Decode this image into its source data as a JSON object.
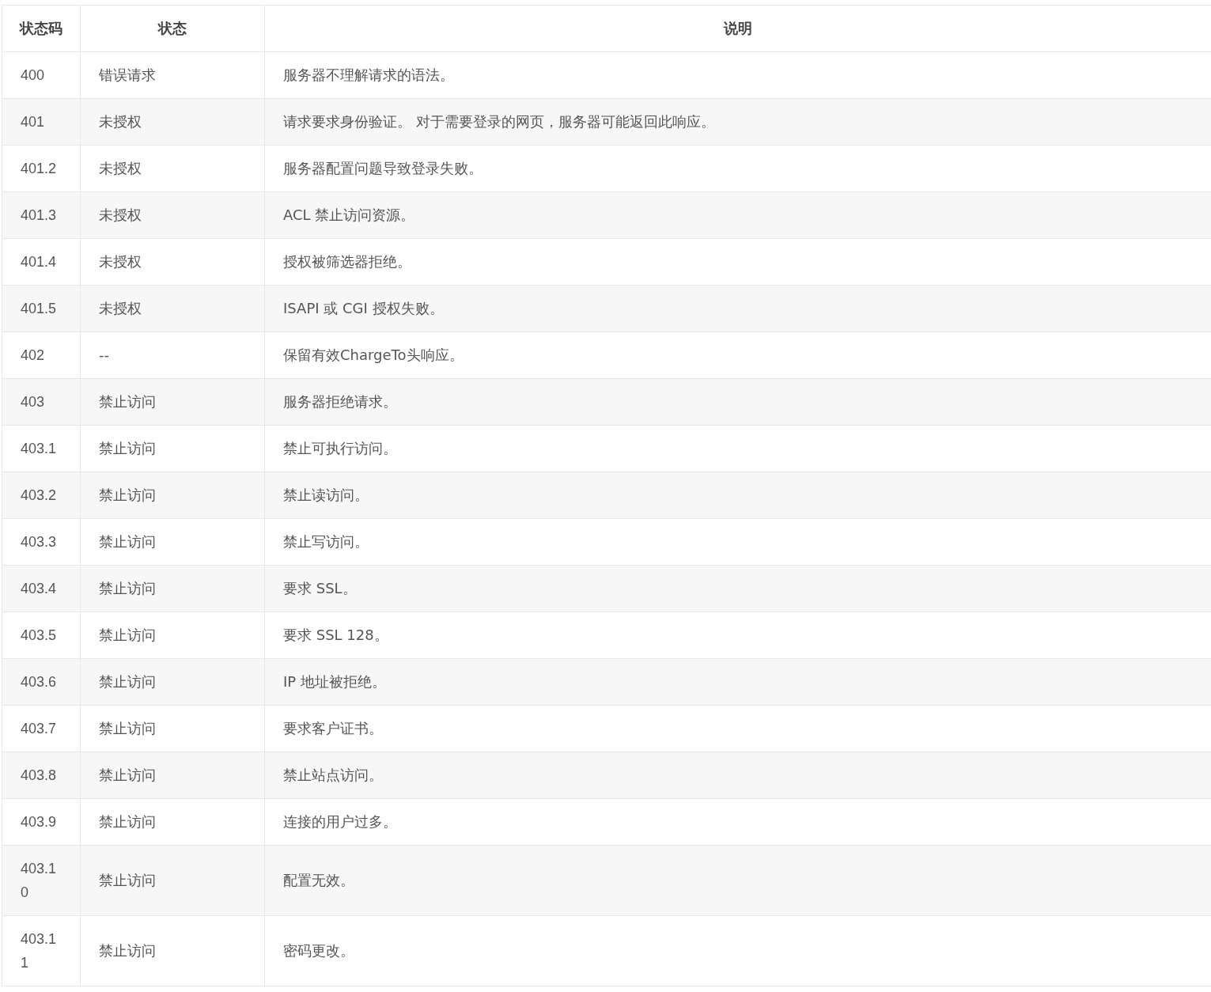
{
  "table": {
    "columns": [
      "状态码",
      "状态",
      "说明"
    ],
    "rows": [
      [
        "400",
        "错误请求",
        "服务器不理解请求的语法。"
      ],
      [
        "401",
        "未授权",
        "请求要求身份验证。 对于需要登录的网页，服务器可能返回此响应。"
      ],
      [
        "401.2",
        "未授权",
        "服务器配置问题导致登录失败。"
      ],
      [
        "401.3",
        "未授权",
        "ACL 禁止访问资源。"
      ],
      [
        "401.4",
        "未授权",
        "授权被筛选器拒绝。"
      ],
      [
        "401.5",
        "未授权",
        "ISAPI 或 CGI 授权失败。"
      ],
      [
        "402",
        "--",
        "保留有效ChargeTo头响应。"
      ],
      [
        "403",
        "禁止访问",
        "服务器拒绝请求。"
      ],
      [
        "403.1",
        "禁止访问",
        "禁止可执行访问。"
      ],
      [
        "403.2",
        "禁止访问",
        "禁止读访问。"
      ],
      [
        "403.3",
        "禁止访问",
        "禁止写访问。"
      ],
      [
        "403.4",
        "禁止访问",
        "要求 SSL。"
      ],
      [
        "403.5",
        "禁止访问",
        "要求 SSL 128。"
      ],
      [
        "403.6",
        "禁止访问",
        "IP 地址被拒绝。"
      ],
      [
        "403.7",
        "禁止访问",
        "要求客户证书。"
      ],
      [
        "403.8",
        "禁止访问",
        "禁止站点访问。"
      ],
      [
        "403.9",
        "禁止访问",
        "连接的用户过多。"
      ],
      [
        "403.10",
        "禁止访问",
        "配置无效。"
      ],
      [
        "403.11",
        "禁止访问",
        "密码更改。"
      ]
    ]
  }
}
